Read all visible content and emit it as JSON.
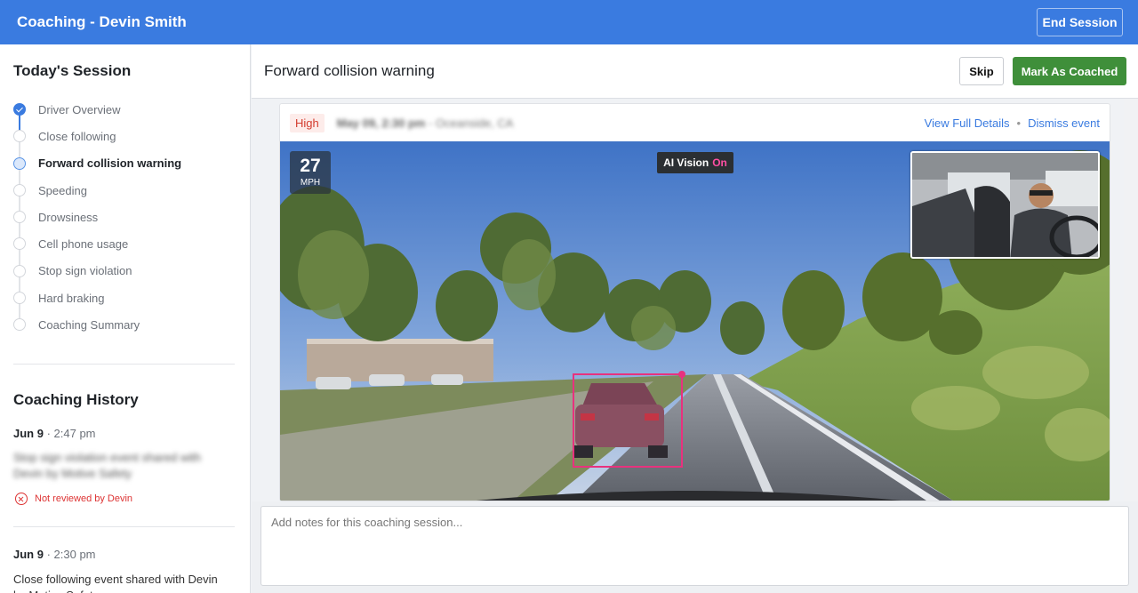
{
  "header": {
    "title": "Coaching - Devin Smith",
    "end_label": "End Session"
  },
  "sidebar": {
    "session_title": "Today's Session",
    "steps": [
      {
        "label": "Driver Overview",
        "state": "done"
      },
      {
        "label": "Close following",
        "state": "pending"
      },
      {
        "label": "Forward collision warning",
        "state": "active"
      },
      {
        "label": "Speeding",
        "state": "pending"
      },
      {
        "label": "Drowsiness",
        "state": "pending"
      },
      {
        "label": "Cell phone usage",
        "state": "pending"
      },
      {
        "label": "Stop sign violation",
        "state": "pending"
      },
      {
        "label": "Hard braking",
        "state": "pending"
      },
      {
        "label": "Coaching Summary",
        "state": "pending"
      }
    ],
    "history_title": "Coaching History",
    "history": [
      {
        "date": "Jun 9",
        "time": "2:47 pm",
        "desc": "Stop sign violation event shared with Devin by Motive Safety",
        "status": "Not reviewed by Devin"
      },
      {
        "date": "Jun 9",
        "time": "2:30 pm",
        "desc": "Close following event shared with Devin by Motive Safety"
      }
    ]
  },
  "main": {
    "title": "Forward collision warning",
    "skip_label": "Skip",
    "coached_label": "Mark As Coached",
    "event": {
      "severity": "High",
      "datetime": "May 09, 2:30 pm",
      "location": "Oceanside, CA",
      "link_details": "View Full Details",
      "link_dismiss": "Dismiss event",
      "separator": "•",
      "speed": "27",
      "speed_unit": "MPH",
      "ai_vision_label": "AI Vision",
      "ai_vision_state": "On",
      "colors": {
        "detection_box": "#e8327e",
        "ai_on": "#ff4fa3"
      }
    },
    "notes_placeholder": "Add notes for this coaching session..."
  },
  "colors": {
    "brand": "#3a7be0",
    "success": "#3f8f3a",
    "danger": "#d33b2d"
  },
  "icons": {
    "step_done": "check-circle-icon",
    "not_reviewed": "x-circle-icon"
  }
}
